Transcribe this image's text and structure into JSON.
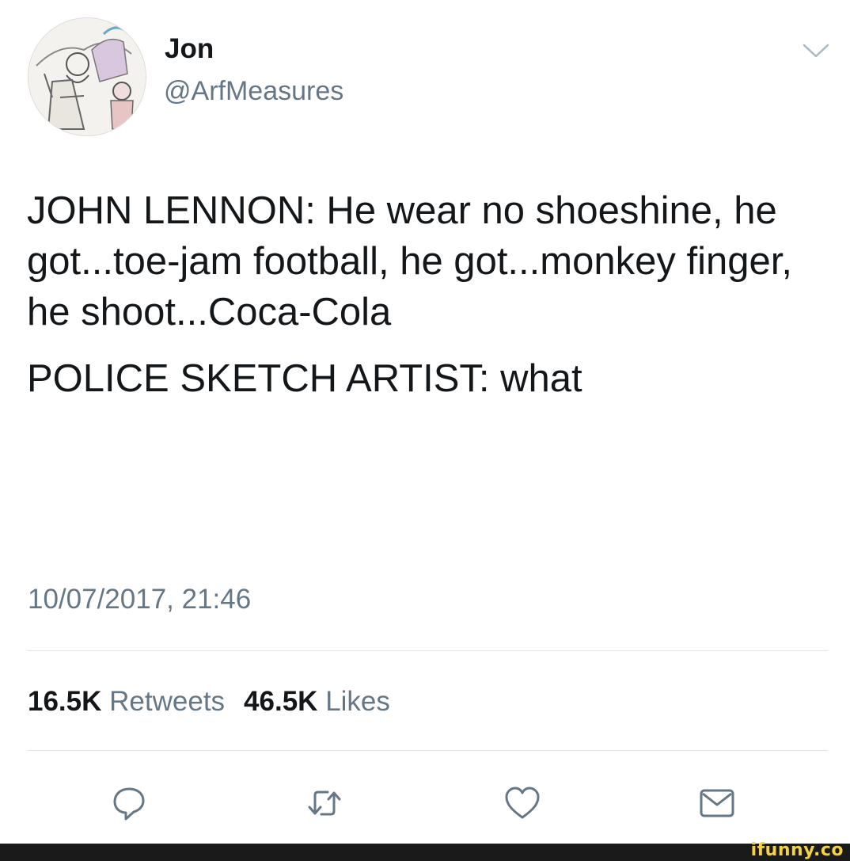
{
  "author": {
    "display_name": "Jon",
    "handle": "@ArfMeasures"
  },
  "tweet": {
    "paragraphs": [
      "JOHN LENNON: He wear no shoeshine, he got...toe-jam football, he got...monkey finger, he shoot...Coca-Cola",
      "POLICE SKETCH ARTIST: what"
    ],
    "timestamp": "10/07/2017, 21:46"
  },
  "stats": {
    "retweets_count": "16.5K",
    "retweets_label": "Retweets",
    "likes_count": "46.5K",
    "likes_label": "Likes"
  },
  "actions": [
    {
      "icon": "reply-icon"
    },
    {
      "icon": "retweet-icon"
    },
    {
      "icon": "like-icon"
    },
    {
      "icon": "message-icon"
    }
  ],
  "watermark": "ifunny.co",
  "colors": {
    "text": "#14171a",
    "secondary": "#657786",
    "divider": "#e1e8ed",
    "watermark": "#f4d33f"
  }
}
